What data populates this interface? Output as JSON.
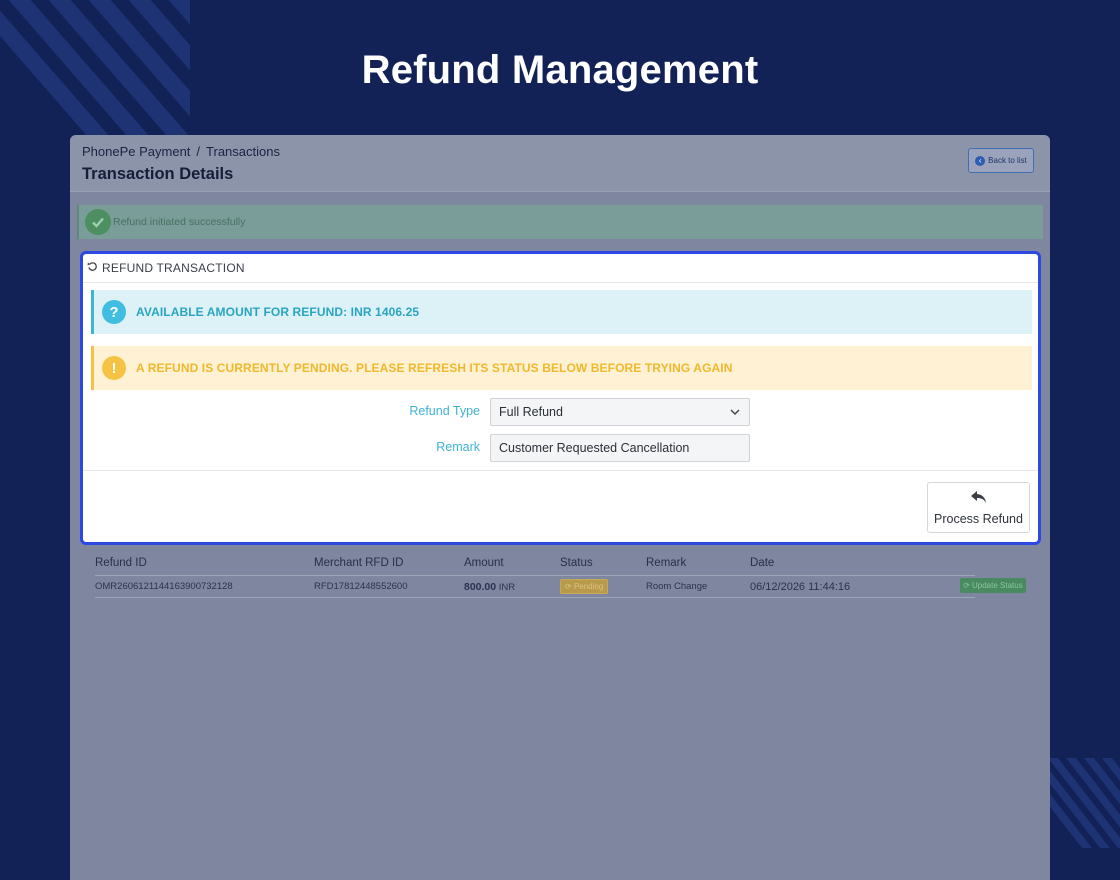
{
  "page": {
    "title": "Refund Management"
  },
  "app": {
    "breadcrumb": [
      "PhonePe Payment",
      "/",
      "Transactions"
    ],
    "header_title": "Transaction Details",
    "back_button": "Back to list",
    "success_message": "Refund initiated successfully"
  },
  "refund_panel": {
    "title": "REFUND TRANSACTION",
    "info_text": "AVAILABLE AMOUNT FOR REFUND: INR 1406.25",
    "warning_text": "A REFUND IS CURRENTLY  PENDING. PLEASE REFRESH ITS STATUS BELOW BEFORE TRYING AGAIN",
    "refund_type_label": "Refund Type",
    "refund_type_value": "Full Refund",
    "remark_label": "Remark",
    "remark_value": "Customer Requested Cancellation",
    "process_button": "Process Refund"
  },
  "refund_history": {
    "columns": [
      "Refund ID",
      "Merchant RFD ID",
      "Amount",
      "Status",
      "Remark",
      "Date"
    ],
    "rows": [
      {
        "refund_id": "OMR2606121144163900732128",
        "merchant_rfd_id": "RFD17812448552600",
        "amount_value": "800.00",
        "amount_currency": "INR",
        "status": "Pending",
        "remark": "Room Change",
        "date": "06/12/2026 11:44:16"
      }
    ],
    "update_button": "Update Status"
  },
  "colors": {
    "background": "#122257",
    "panel_border": "#2b48e0",
    "info": "#3db5d4",
    "warning": "#f5c344"
  }
}
